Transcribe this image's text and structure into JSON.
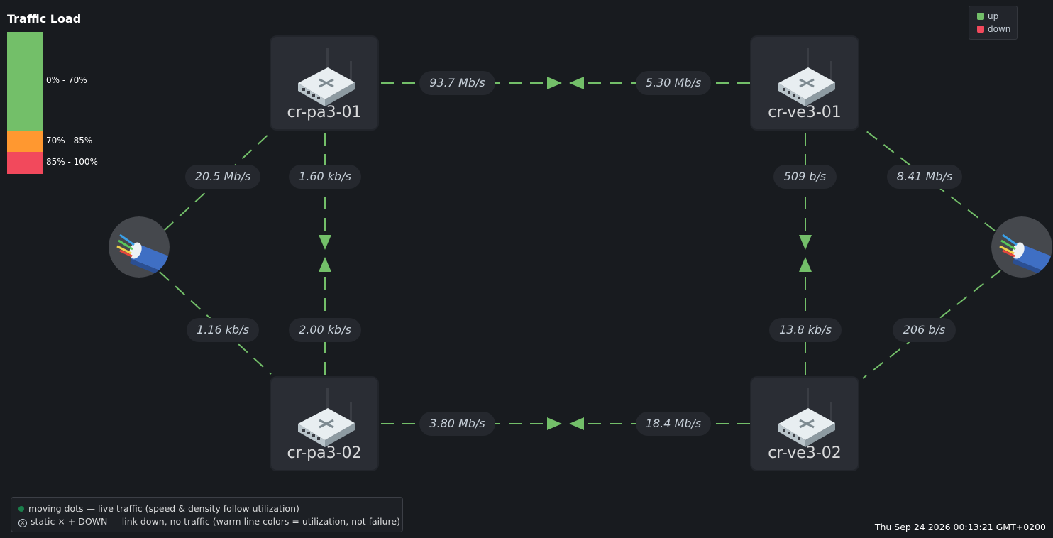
{
  "colors": {
    "background": "#181b1f",
    "link_up": "#73bf69",
    "load_low": "#73bf69",
    "load_mid": "#ff9830",
    "load_high": "#f2495c",
    "legend_up": "#73bf69",
    "legend_down": "#f2495c",
    "live_dot": "#1a7f4b"
  },
  "traffic_load": {
    "title": "Traffic Load",
    "bands": [
      {
        "label": "0% - 70%",
        "color": "#73bf69"
      },
      {
        "label": "70% - 85%",
        "color": "#ff9830"
      },
      {
        "label": "85% - 100%",
        "color": "#f2495c"
      }
    ]
  },
  "legend": {
    "up_label": "up",
    "down_label": "down"
  },
  "nodes": [
    {
      "id": "pa1",
      "label": "cr-pa3-01",
      "icon": "router-icon"
    },
    {
      "id": "pa2",
      "label": "cr-pa3-02",
      "icon": "router-icon"
    },
    {
      "id": "ve1",
      "label": "cr-ve3-01",
      "icon": "router-icon"
    },
    {
      "id": "ve2",
      "label": "cr-ve3-02",
      "icon": "router-icon"
    },
    {
      "id": "cl",
      "label": "",
      "icon": "fiber-cable-icon"
    },
    {
      "id": "cr",
      "label": "",
      "icon": "fiber-cable-icon"
    }
  ],
  "links": [
    {
      "from": "pa1",
      "to": "ve1",
      "rate_out": "93.7 Mb/s",
      "rate_in": "5.30 Mb/s",
      "status": "up"
    },
    {
      "from": "pa2",
      "to": "ve2",
      "rate_out": "3.80 Mb/s",
      "rate_in": "18.4 Mb/s",
      "status": "up"
    },
    {
      "from": "pa1",
      "to": "pa2",
      "rate_out": "1.60 kb/s",
      "rate_in": "2.00 kb/s",
      "status": "up"
    },
    {
      "from": "ve1",
      "to": "ve2",
      "rate_out": "509 b/s",
      "rate_in": "13.8 kb/s",
      "status": "up"
    },
    {
      "from": "cl",
      "to": "pa1",
      "rate": "20.5 Mb/s",
      "status": "up"
    },
    {
      "from": "cl",
      "to": "pa2",
      "rate": "1.16 kb/s",
      "status": "up"
    },
    {
      "from": "cr",
      "to": "ve1",
      "rate": "8.41 Mb/s",
      "status": "up"
    },
    {
      "from": "cr",
      "to": "ve2",
      "rate": "206 b/s",
      "status": "up"
    }
  ],
  "help": {
    "live_text": "moving dots — live traffic (speed & density follow utilization)",
    "down_text": "static × + DOWN — link down, no traffic (warm line colors = utilization, not failure)"
  },
  "timestamp": "Thu Sep 24 2026 00:13:21 GMT+0200"
}
